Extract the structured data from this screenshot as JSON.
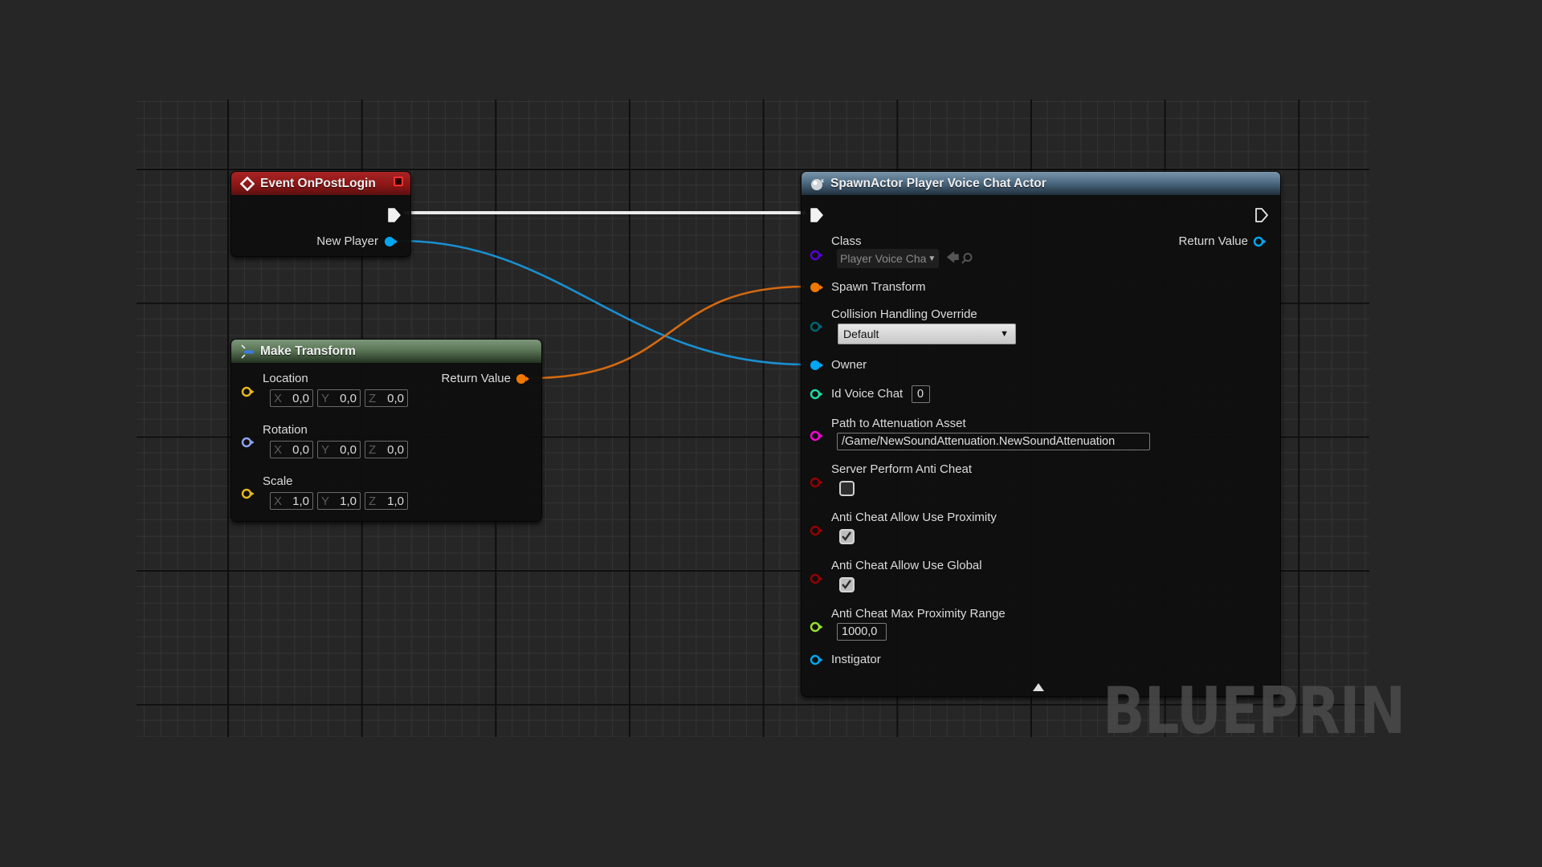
{
  "watermark": "BLUEPRIN",
  "colors": {
    "exec": "#ffffff",
    "object": "#00a8f3",
    "struct_transform": "#f07800",
    "struct_vector": "#f2c33c",
    "struct_rotator": "#9fb2ff",
    "class": "#5a00d4",
    "byte_enum": "#006575",
    "integer": "#1edba7",
    "string": "#fc00d9",
    "boolean": "#950000",
    "float": "#97e22c"
  },
  "nodes": {
    "event": {
      "title": "Event OnPostLogin",
      "icon": "event-diamond-icon",
      "outputs": [
        {
          "label": "",
          "type": "exec",
          "connected": true
        },
        {
          "label": "New Player",
          "type": "object",
          "connected": true
        }
      ]
    },
    "make_transform": {
      "title": "Make Transform",
      "icon": "function-icon",
      "inputs": [
        {
          "label": "Location",
          "type": "vector",
          "x": "0,0",
          "y": "0,0",
          "z": "0,0"
        },
        {
          "label": "Rotation",
          "type": "rotator",
          "x": "0,0",
          "y": "0,0",
          "z": "0,0"
        },
        {
          "label": "Scale",
          "type": "vector",
          "x": "1,0",
          "y": "1,0",
          "z": "1,0"
        }
      ],
      "output": {
        "label": "Return Value",
        "type": "transform",
        "connected": true
      },
      "axis_labels": {
        "x": "X",
        "y": "Y",
        "z": "Z"
      }
    },
    "spawn": {
      "title": "SpawnActor Player Voice Chat Actor",
      "icon": "spawn-actor-icon",
      "return_label": "Return Value",
      "class_label": "Class",
      "class_value": "Player Voice Cha",
      "spawn_transform_label": "Spawn Transform",
      "collision_label": "Collision Handling Override",
      "collision_value": "Default",
      "owner_label": "Owner",
      "id_voice_chat_label": "Id Voice Chat",
      "id_voice_chat_value": "0",
      "path_label": "Path to Attenuation Asset",
      "path_value": "/Game/NewSoundAttenuation.NewSoundAttenuation",
      "server_anticheat_label": "Server Perform Anti Cheat",
      "server_anticheat_checked": false,
      "allow_proximity_label": "Anti Cheat Allow Use Proximity",
      "allow_proximity_checked": true,
      "allow_global_label": "Anti Cheat Allow Use Global",
      "allow_global_checked": true,
      "max_range_label": "Anti Cheat Max Proximity Range",
      "max_range_value": "1000,0",
      "instigator_label": "Instigator"
    }
  }
}
